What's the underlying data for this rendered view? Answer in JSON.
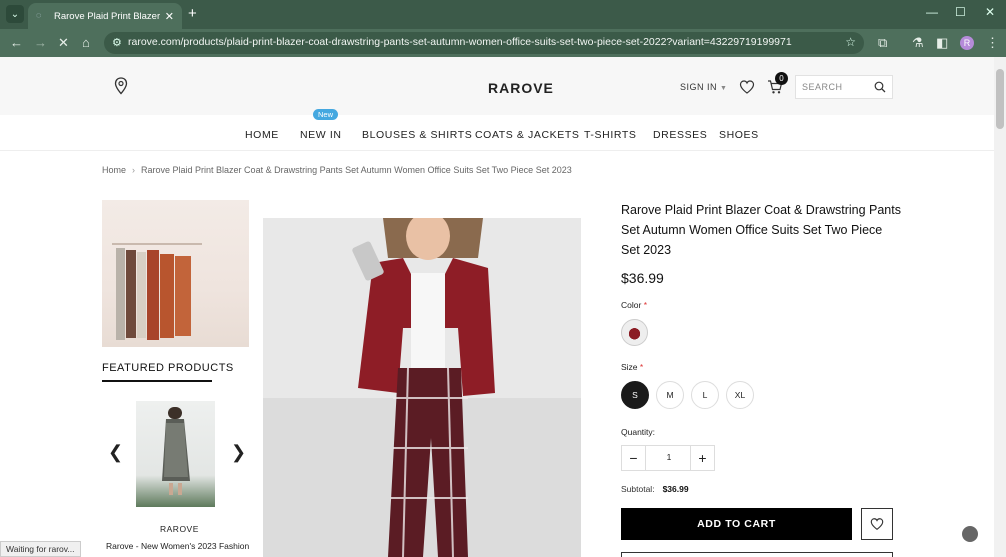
{
  "browser": {
    "tab_title": "Rarove Plaid Print Blazer Coat",
    "url": "rarove.com/products/plaid-print-blazer-coat-drawstring-pants-set-autumn-women-office-suits-set-two-piece-set-2022?variant=43229719199971",
    "profile_initial": "R",
    "status_text": "Waiting for rarov..."
  },
  "header": {
    "logo": "RAROVE",
    "sign_in": "SIGN IN",
    "cart_count": "0",
    "search_placeholder": "SEARCH"
  },
  "nav": {
    "badge": "New",
    "items": [
      "HOME",
      "NEW IN",
      "BLOUSES & SHIRTS",
      "COATS & JACKETS",
      "T-SHIRTS",
      "DRESSES",
      "SHOES"
    ]
  },
  "breadcrumb": {
    "home": "Home",
    "current": "Rarove Plaid Print Blazer Coat & Drawstring Pants Set Autumn Women Office Suits Set Two Piece Set 2023"
  },
  "sidebar": {
    "featured_title": "FEATURED PRODUCTS",
    "featured_brand": "RAROVE",
    "featured_name": "Rarove - New Women's 2023 Fashion"
  },
  "product": {
    "title": "Rarove Plaid Print Blazer Coat & Drawstring Pants Set Autumn Women Office Suits Set Two Piece Set 2023",
    "price": "$36.99",
    "color_label": "Color",
    "size_label": "Size",
    "required_mark": "*",
    "sizes": [
      "S",
      "M",
      "L",
      "XL"
    ],
    "selected_size": "S",
    "quantity_label": "Quantity:",
    "quantity": "1",
    "subtotal_label": "Subtotal:",
    "subtotal_value": "$36.99",
    "add_to_cart": "ADD TO CART"
  }
}
